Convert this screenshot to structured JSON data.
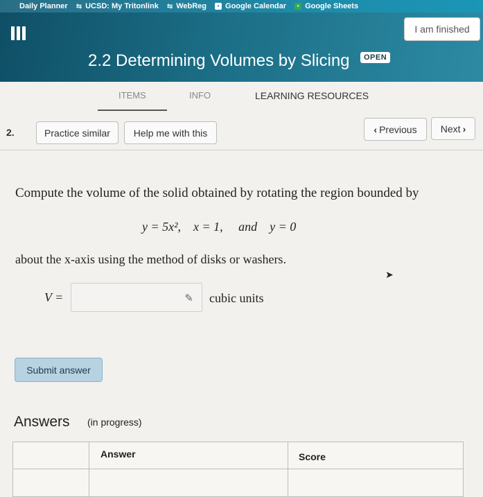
{
  "bookmarks": [
    {
      "label": "Daily Planner",
      "icon": "none"
    },
    {
      "label": "UCSD: My Tritonlink",
      "icon": "link-icon"
    },
    {
      "label": "WebReg",
      "icon": "link-icon"
    },
    {
      "label": "Google Calendar",
      "icon": "calendar-icon"
    },
    {
      "label": "Google Sheets",
      "icon": "sheets-icon"
    }
  ],
  "header": {
    "title": "2.2 Determining Volumes by Slicing",
    "status_badge": "OPEN",
    "finished_button": "I am finished"
  },
  "tabs": {
    "items": "ITEMS",
    "info": "INFO",
    "learning_resources": "LEARNING RESOURCES"
  },
  "problem": {
    "number": "2.",
    "practice_similar": "Practice similar",
    "help_button": "Help me with this",
    "previous": "Previous",
    "next": "Next",
    "prompt": "Compute the volume of the solid obtained by rotating the region bounded by",
    "equation": "y = 5x²,    x = 1,     and    y = 0",
    "about": "about the x-axis using the method of disks or washers.",
    "answer_label": "V =",
    "answer_value": "",
    "units": "cubic units",
    "submit": "Submit answer"
  },
  "answers": {
    "title": "Answers",
    "status": "(in progress)",
    "col_answer": "Answer",
    "col_score": "Score"
  },
  "colors": {
    "header_bg": "#1b6e86",
    "submit_bg": "#b7d3e2"
  }
}
